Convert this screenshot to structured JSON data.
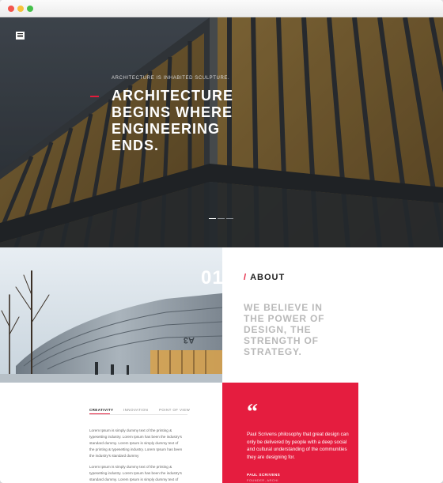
{
  "window": {
    "controls": [
      "close",
      "minimize",
      "maximize"
    ]
  },
  "hero": {
    "menu_icon": "hamburger-menu-icon",
    "tagline": "Architecture is inhabited sculpture.",
    "title_lines": [
      "ARCHITECTURE",
      "BEGINS WHERE",
      "ENGINEERING",
      "ENDS."
    ],
    "slider": {
      "slides": 3,
      "active_index": 0
    }
  },
  "about": {
    "number": "01",
    "heading": "ABOUT",
    "heading_marker": "/",
    "statement": "WE BELIEVE IN THE POWER OF DESIGN, THE STRENGTH OF STRATEGY."
  },
  "tabs": {
    "items": [
      "CREATIVITY",
      "INNOVATION",
      "POINT OF VIEW"
    ],
    "active_index": 0
  },
  "paragraphs": [
    "Lorem Ipsum is simply dummy text of the printing & typesetting industry. Lorem Ipsum has been the industry's standard dummy. Lorem Ipsum is simply dummy text of the printing & typesetting industry. Lorem Ipsum has been the industry's standard dummy",
    "Lorem Ipsum is simply dummy text of the printing & typesetting industry. Lorem Ipsum has been the industry's standard dummy. Lorem Ipsum is simply dummy text of the printing & typesetting industry."
  ],
  "quote": {
    "mark": "“",
    "text": "Paul Scrivens philosophy that great design can only be delivered by people with a deep social and cultural understanding of the communities they are designing for.",
    "author": "PAUL SCRIVENS",
    "role": "FOUNDER, ARCHI"
  },
  "colors": {
    "accent": "#e51d3f",
    "hero_bg": "#3f474f",
    "statement_gray": "#b9b9b9"
  }
}
